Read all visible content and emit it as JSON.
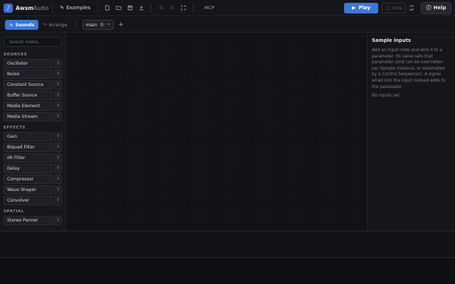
{
  "app": {
    "brand_main": "Awsm",
    "brand_sub": "Audio",
    "logo_icon": "tuning-fork-icon"
  },
  "toolbar": {
    "examples_label": "Examples",
    "mcp_label": "MCP",
    "play_label": "Play",
    "stop_label": "Stop",
    "help_label": "Help"
  },
  "views": {
    "sounds_label": "Sounds",
    "arrange_label": "Arrange"
  },
  "graph_tab": {
    "name": "main",
    "count": "1",
    "close": "×",
    "add": "+"
  },
  "search": {
    "placeholder": "Search nodes..."
  },
  "sidebar": {
    "sections": [
      {
        "title": "SOURCES",
        "items": [
          "Oscillator",
          "Noise",
          "Constant Source",
          "Buffer Source",
          "Media Element",
          "Media Stream"
        ]
      },
      {
        "title": "EFFECTS",
        "items": [
          "Gain",
          "Biquad Filter",
          "IIR Filter",
          "Delay",
          "Compressor",
          "Wave Shaper",
          "Convolver"
        ]
      },
      {
        "title": "SPATIAL",
        "items": [
          "Stereo Panner"
        ]
      }
    ],
    "help_glyph": "?"
  },
  "inspector": {
    "title": "Sample inputs",
    "description": "Add an Input node and wire it to a parameter. Its value sets that parameter (and can be overridden per Sample instance, or automated by a Control Sequencer). A signal wired into the input instead adds to the parameter.",
    "empty": "No inputs yet."
  },
  "colors": {
    "accent": "#3c77d9",
    "background": "#0f1013",
    "panel": "#15161a"
  }
}
